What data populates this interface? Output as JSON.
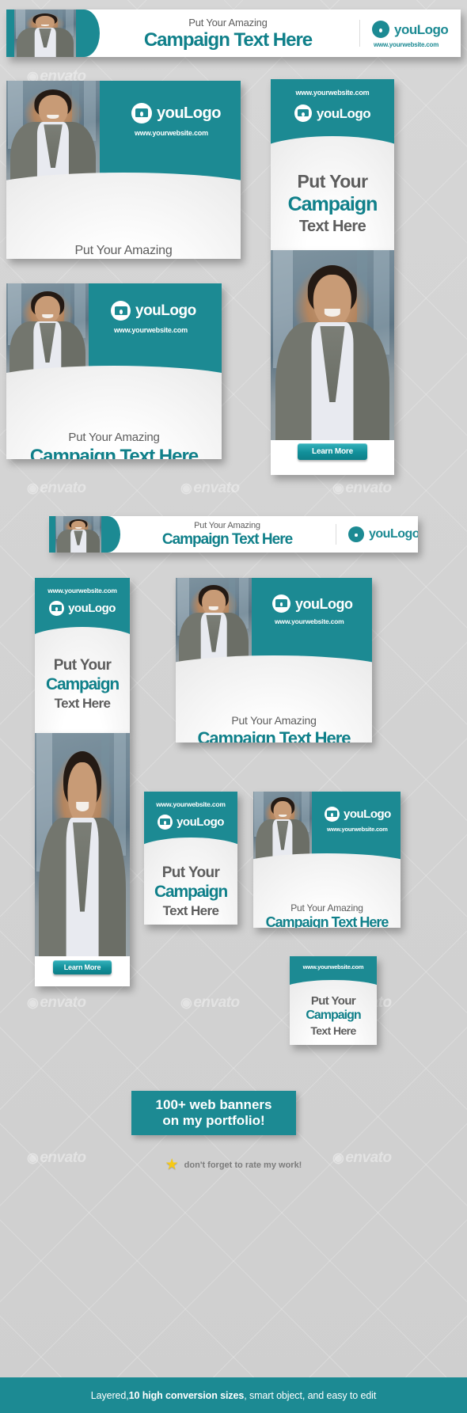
{
  "brand": {
    "logo_text": "youLogo",
    "website": "www.yourwebsite.com",
    "accent_color": "#1c8a93",
    "headline_color": "#10808a",
    "subtext_color": "#5d5d5d",
    "background_color": "#d4d4d4"
  },
  "copy": {
    "line_small": "Put Your Amazing",
    "line_big": "Campaign Text Here",
    "stack_1": "Put Your",
    "stack_2": "Campaign",
    "stack_3": "Text Here",
    "cta": "Learn More"
  },
  "icons": {
    "logo": "camera-logo-icon",
    "star": "star-icon"
  },
  "watermark": {
    "text": "envato"
  },
  "banners": [
    {
      "id": "leaderboard-top",
      "name": "banner-728x90-top",
      "layout": "horizontal"
    },
    {
      "id": "medium-rectangle",
      "name": "banner-300x250",
      "layout": "stacked"
    },
    {
      "id": "rectangle-336",
      "name": "banner-336x280",
      "layout": "stacked"
    },
    {
      "id": "half-page-right",
      "name": "banner-300x600",
      "layout": "vertical"
    },
    {
      "id": "leaderboard-mid",
      "name": "banner-728x90-mid",
      "layout": "horizontal"
    },
    {
      "id": "skyscraper-left",
      "name": "banner-160x600",
      "layout": "vertical"
    },
    {
      "id": "rectangle-mid",
      "name": "banner-300x250-mid",
      "layout": "stacked"
    },
    {
      "id": "vertical-small",
      "name": "banner-120x600",
      "layout": "vertical"
    },
    {
      "id": "rectangle-small",
      "name": "banner-250x250",
      "layout": "stacked"
    },
    {
      "id": "square-small",
      "name": "banner-200x200",
      "layout": "stacked"
    }
  ],
  "footer": {
    "promo_line_1": "100+ web banners",
    "promo_line_2": "on my portfolio!",
    "rate_text": "don't forget to rate my work!",
    "features_prefix": "Layered, ",
    "features_bold": "10 high conversion sizes",
    "features_suffix": ", smart object, and easy to edit"
  }
}
